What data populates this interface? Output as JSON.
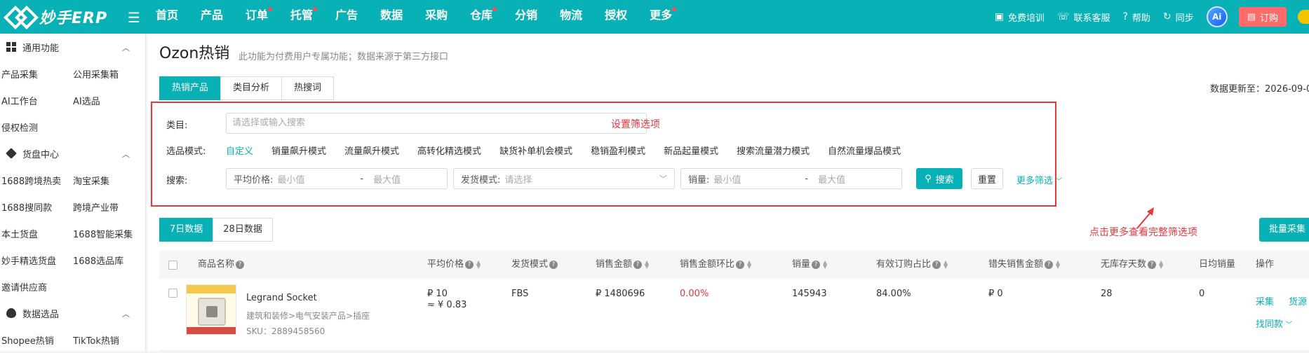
{
  "brand": {
    "name": "妙手ERP"
  },
  "nav": [
    {
      "label": "首页",
      "dot": false
    },
    {
      "label": "产品",
      "dot": false
    },
    {
      "label": "订单",
      "dot": true
    },
    {
      "label": "托管",
      "dot": true
    },
    {
      "label": "广告",
      "dot": false
    },
    {
      "label": "数据",
      "dot": false
    },
    {
      "label": "采购",
      "dot": false
    },
    {
      "label": "仓库",
      "dot": true
    },
    {
      "label": "分销",
      "dot": false
    },
    {
      "label": "物流",
      "dot": false
    },
    {
      "label": "授权",
      "dot": false
    },
    {
      "label": "更多",
      "dot": true
    }
  ],
  "topright": {
    "training": "免费培训",
    "support": "联系客服",
    "help": "帮助",
    "sync": "同步",
    "ai": "Ai",
    "order": "订购"
  },
  "sidebar": {
    "sections": [
      {
        "title": "通用功能",
        "icon": "grid-icon",
        "items": [
          "产品采集",
          "公用采集箱",
          "AI工作台",
          "AI选品",
          "侵权检测"
        ]
      },
      {
        "title": "货盘中心",
        "icon": "cube-icon",
        "items": [
          "1688跨境热卖",
          "淘宝采集",
          "1688搜同款",
          "跨境产业带",
          "本土货盘",
          "1688智能采集",
          "妙手精选货盘",
          "1688选品库",
          "邀请供应商"
        ]
      },
      {
        "title": "数据选品",
        "icon": "fire-icon",
        "items": [
          "Shopee热销",
          "TikTok热销"
        ]
      }
    ]
  },
  "page": {
    "title": "Ozon热销",
    "subtitle": "此功能为付费用户专属功能；数据来源于第三方接口",
    "tabs": [
      "热销产品",
      "类目分析",
      "热搜词"
    ],
    "active_tab": 0,
    "updated": "数据更新至：2026-09-0"
  },
  "filters": {
    "category_label": "类目:",
    "category_placeholder": "请选择或输入搜索",
    "hint_set": "设置筛选项",
    "mode_label": "选品模式:",
    "modes": [
      "自定义",
      "销量飙升模式",
      "流量飙升模式",
      "高转化精选模式",
      "缺货补单机会模式",
      "稳销盈利模式",
      "新品起量模式",
      "搜索流量潜力模式",
      "自然流量爆品模式"
    ],
    "active_mode": 0,
    "search_label": "搜索:",
    "price_label": "平均价格:",
    "min_placeholder": "最小值",
    "max_placeholder": "最大值",
    "dash": "-",
    "ship_label": "发货模式:",
    "ship_placeholder": "请选择",
    "sales_label": "销量:",
    "search_button": "搜索",
    "reset_button": "重置",
    "more_filters": "更多筛选",
    "hint_more": "点击更多查看完整筛选项"
  },
  "data_tabs": [
    "7日数据",
    "28日数据"
  ],
  "active_data_tab": 0,
  "batch_button": "批量采集",
  "columns": [
    "商品名称",
    "平均价格",
    "发货模式",
    "销售金额",
    "销售金额环比",
    "销量",
    "有效订购占比",
    "错失销售金额",
    "无库存天数",
    "日均销量",
    "操作"
  ],
  "rows": [
    {
      "name": "Legrand Socket",
      "category": "建筑和装修>电气安装产品>插座",
      "sku": "SKU：2889458560",
      "price": "₽ 10",
      "price_cny": "≈ ¥ 0.83",
      "ship": "FBS",
      "sales_amount": "₽ 1480696",
      "sales_change": "0.00%",
      "sales": "145943",
      "order_ratio": "84.00%",
      "lost_sales": "₽ 0",
      "no_stock_days": "28",
      "daily_sales": "0",
      "actions": [
        "采集",
        "货源",
        "找同款"
      ]
    }
  ],
  "colors": {
    "primary": "#07b1b5",
    "alert": "#e8363d",
    "order_btn": "#ff6b6b"
  }
}
